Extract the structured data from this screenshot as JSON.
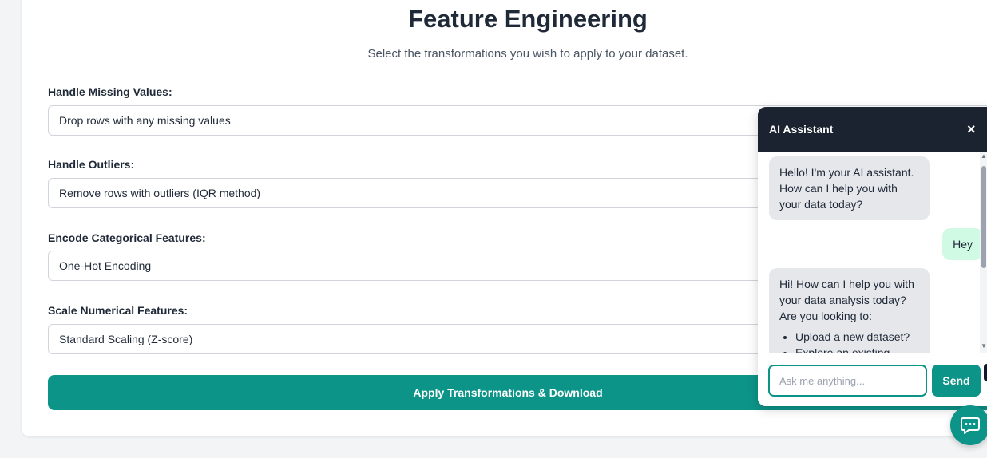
{
  "page": {
    "title": "Feature Engineering",
    "subtitle": "Select the transformations you wish to apply to your dataset."
  },
  "fields": [
    {
      "label": "Handle Missing Values:",
      "value": "Drop rows with any missing values"
    },
    {
      "label": "Handle Outliers:",
      "value": "Remove rows with outliers (IQR method)"
    },
    {
      "label": "Encode Categorical Features:",
      "value": "One-Hot Encoding"
    },
    {
      "label": "Scale Numerical Features:",
      "value": "Standard Scaling (Z-score)"
    }
  ],
  "apply_button": {
    "label": "Apply Transformations & Download"
  },
  "chat": {
    "title": "AI Assistant",
    "close_icon": "×",
    "messages": [
      {
        "role": "assistant",
        "text": "Hello! I'm your AI assistant. How can I help you with your data today?"
      },
      {
        "role": "user",
        "text": "Hey"
      },
      {
        "role": "assistant",
        "text": "Hi! How can I help you with your data analysis today? Are you looking to:",
        "bullets": [
          "Upload a new dataset?",
          "Explore an existing"
        ]
      }
    ],
    "input_placeholder": "Ask me anything...",
    "send_label": "Send"
  },
  "icons": {
    "close": "close-icon",
    "chat_fab": "chat-bubble-icon"
  },
  "colors": {
    "accent": "#0d9488",
    "chat_header": "#1b2330",
    "user_bubble": "#d1fae5",
    "assistant_bubble": "#e5e7eb"
  }
}
